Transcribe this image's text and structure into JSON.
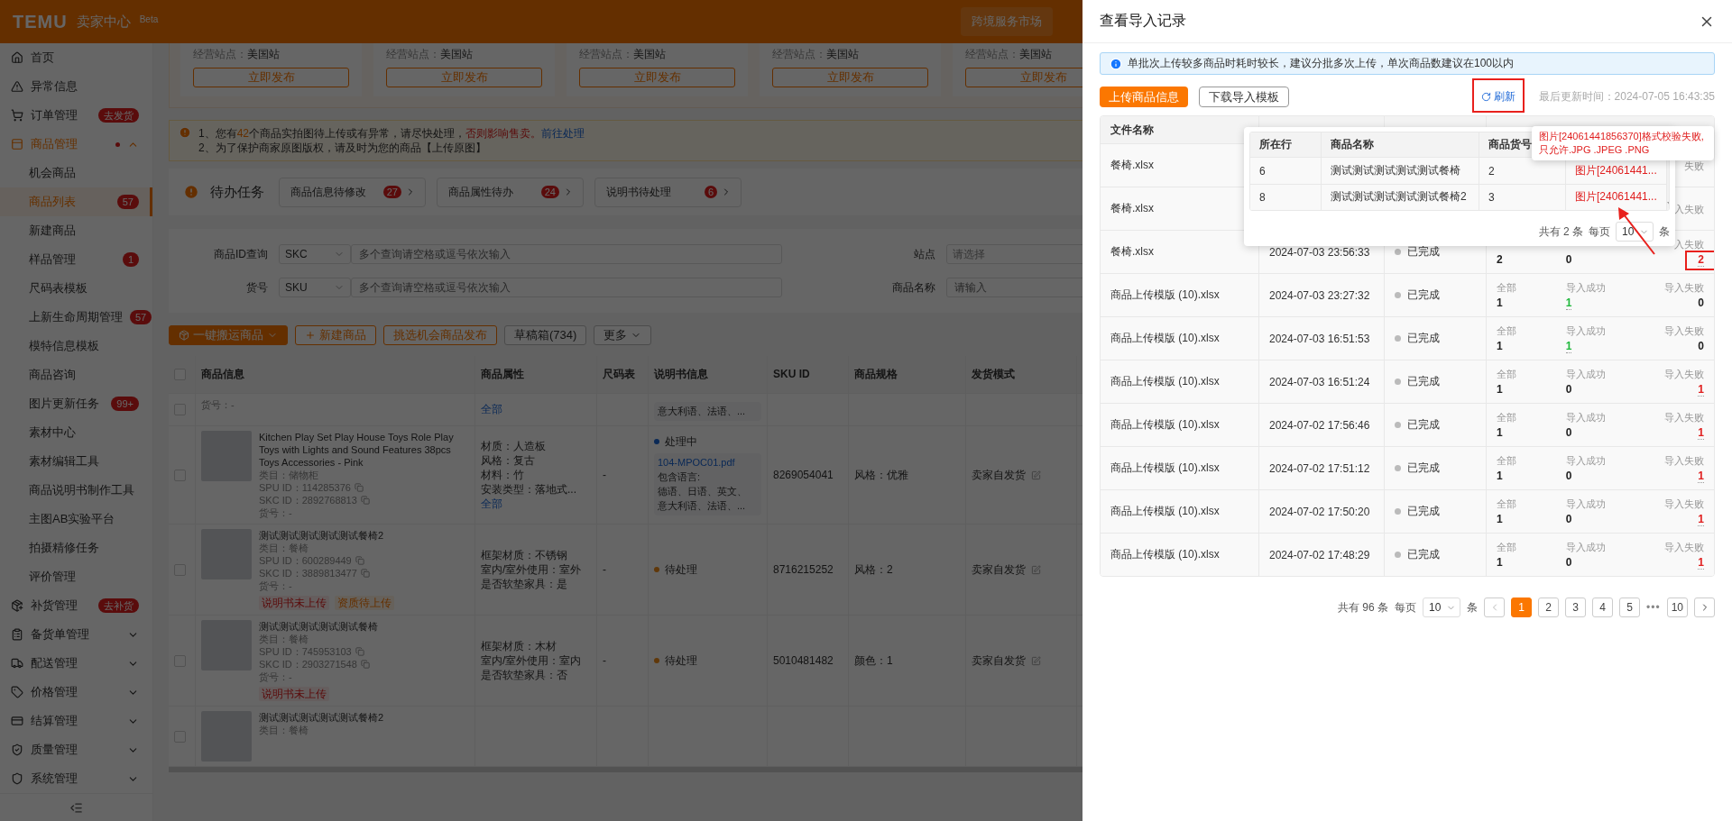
{
  "header": {
    "logo": "TEMU",
    "product": "卖家中心",
    "badge": "Beta",
    "market_button": "跨境服务市场"
  },
  "sidebar": {
    "items": [
      {
        "label": "首页",
        "selected": false
      },
      {
        "label": "异常信息",
        "selected": false
      },
      {
        "label": "订单管理",
        "selected": false,
        "tag": "去发货"
      },
      {
        "label": "商品管理",
        "selected": false,
        "expanded": true,
        "dot": true,
        "children": [
          {
            "label": "机会商品",
            "selected": false
          },
          {
            "label": "商品列表",
            "selected": true,
            "count": "57"
          },
          {
            "label": "新建商品",
            "selected": false
          },
          {
            "label": "样品管理",
            "selected": false,
            "count": "1"
          },
          {
            "label": "尺码表模板",
            "selected": false
          },
          {
            "label": "上新生命周期管理",
            "selected": false,
            "count": "57"
          },
          {
            "label": "模特信息模板",
            "selected": false
          },
          {
            "label": "商品咨询",
            "selected": false
          },
          {
            "label": "图片更新任务",
            "selected": false,
            "count": "99+"
          },
          {
            "label": "素材中心",
            "selected": false
          },
          {
            "label": "素材编辑工具",
            "selected": false
          },
          {
            "label": "商品说明书制作工具",
            "selected": false
          },
          {
            "label": "主图AB实验平台",
            "selected": false
          },
          {
            "label": "拍摄精修任务",
            "selected": false
          },
          {
            "label": "评价管理",
            "selected": false
          }
        ]
      },
      {
        "label": "补货管理",
        "selected": false,
        "tag": "去补货"
      },
      {
        "label": "备货单管理",
        "selected": false,
        "expanded": false
      },
      {
        "label": "配送管理",
        "selected": false,
        "expanded": false
      },
      {
        "label": "价格管理",
        "selected": false,
        "expanded": false
      },
      {
        "label": "结算管理",
        "selected": false,
        "expanded": false
      },
      {
        "label": "质量管理",
        "selected": false,
        "expanded": false
      },
      {
        "label": "系统管理",
        "selected": false,
        "expanded": false
      }
    ]
  },
  "publish_cards": [
    {
      "site_label": "经营站点：",
      "site": "美国站",
      "button": "立即发布"
    },
    {
      "site_label": "经营站点：",
      "site": "美国站",
      "button": "立即发布"
    },
    {
      "site_label": "经营站点：",
      "site": "美国站",
      "button": "立即发布"
    },
    {
      "site_label": "经营站点：",
      "site": "美国站",
      "button": "立即发布"
    },
    {
      "site_label": "经营站点：",
      "site": "美国站",
      "button": "立即发布"
    }
  ],
  "notice": {
    "lines": [
      [
        {
          "text": "1、您有",
          "kind": "plain"
        },
        {
          "text": "42",
          "kind": "count"
        },
        {
          "text": "个商品实拍图待上传或有异常，请尽快处理，",
          "kind": "plain"
        },
        {
          "text": "否则影响售卖。",
          "kind": "warning"
        },
        {
          "text": "前往处理",
          "kind": "link"
        }
      ],
      [
        {
          "text": "2、为了保护商家原图版权，请及时为您的商品【上传原图】",
          "kind": "plain"
        }
      ]
    ]
  },
  "todo": {
    "title": "待办任务",
    "items": [
      {
        "label": "商品信息待修改",
        "count": "27"
      },
      {
        "label": "商品属性待办",
        "count": "24"
      },
      {
        "label": "说明书待处理",
        "count": "6"
      }
    ]
  },
  "filters": [
    {
      "kind": "combo",
      "label": "商品ID查询",
      "select": "SKC",
      "placeholder": "多个查询请空格或逗号依次输入"
    },
    {
      "kind": "select",
      "label": "站点",
      "placeholder": "请选择"
    },
    {
      "kind": "combo",
      "label": "货号",
      "select": "SKU",
      "placeholder": "多个查询请空格或逗号依次输入"
    },
    {
      "kind": "input",
      "label": "商品名称",
      "placeholder": "请输入"
    }
  ],
  "actions": [
    {
      "label": "一键搬运商品",
      "kind": "primary"
    },
    {
      "label": "新建商品",
      "kind": "add"
    },
    {
      "label": "挑选机会商品发布",
      "kind": "outline"
    },
    {
      "label": "草稿箱(734)",
      "kind": "plain"
    },
    {
      "label": "更多",
      "kind": "menu"
    }
  ],
  "product_table": {
    "select_all_checked": false,
    "columns": [
      "商品信息",
      "商品属性",
      "尺码表",
      "说明书信息",
      "SKU ID",
      "商品规格",
      "发货模式"
    ],
    "rows": [
      {
        "checked": false,
        "info": [
          "货号：-"
        ],
        "attributes_more": "全部",
        "manual": {
          "languages": [
            "意大利语、法语、..."
          ]
        }
      },
      {
        "checked": false,
        "photo": true,
        "title": "Kitchen Play Set Play House Toys Role Play Toys with Lights and Sound Features 38pcs Toys Accessories - Pink",
        "category": "类目：储物柜",
        "spu": "SPU ID：114285376",
        "skc": "SKC ID：2892768813",
        "item_no": "货号：-",
        "attributes": [
          "材质：人造板",
          "风格：复古",
          "材料：竹",
          "安装类型：落地式..."
        ],
        "attributes_more": "全部",
        "size_chart": "-",
        "manual": {
          "status": "处理中",
          "kind": "processing",
          "file": "104-MPOC01.pdf",
          "languages_label": "包含语言:",
          "languages": [
            "德语、日语、英文、",
            "意大利语、法语、..."
          ]
        },
        "sku_id": "8269054041",
        "spec": "风格：优雅",
        "shipping": "卖家自发货"
      },
      {
        "checked": false,
        "photo": true,
        "title": "测试测试测试测试测试餐椅2",
        "category": "类目：餐椅",
        "spu": "SPU ID：600289449",
        "skc": "SKC ID：3889813477",
        "item_no": "货号：-",
        "tags": [
          {
            "label": "说明书未上传",
            "kind": "error"
          },
          {
            "label": "资质待上传",
            "kind": "warning"
          }
        ],
        "attributes": [
          "框架材质：不锈钢",
          "室内/室外使用：室外",
          "是否软垫家具：是"
        ],
        "size_chart": "-",
        "manual": {
          "status": "待处理",
          "kind": "pending"
        },
        "sku_id": "8716215252",
        "spec": "风格：2",
        "shipping": "卖家自发货"
      },
      {
        "checked": false,
        "photo": true,
        "title": "测试测试测试测试测试餐椅",
        "category": "类目：餐椅",
        "spu": "SPU ID：745953103",
        "skc": "SKC ID：2903271548",
        "item_no": "货号：-",
        "tags": [
          {
            "label": "说明书未上传",
            "kind": "error"
          }
        ],
        "attributes": [
          "框架材质：木材",
          "室内/室外使用：室内",
          "是否软垫家具：否"
        ],
        "size_chart": "-",
        "manual": {
          "status": "待处理",
          "kind": "pending"
        },
        "sku_id": "5010481482",
        "spec": "颜色：1",
        "shipping": "卖家自发货"
      },
      {
        "checked": false,
        "photo": true,
        "title": "测试测试测试测试测试餐椅2",
        "category": "类目：餐椅"
      }
    ]
  },
  "import_drawer": {
    "title": "查看导入记录",
    "alert": "单批次上传较多商品时耗时较长，建议分批多次上传，单次商品数建议在100以内",
    "upload_button": "上传商品信息",
    "download_button": "下载导入模板",
    "refresh": "刷新",
    "last_update": "最后更新时间：2024-07-05 16:43:35",
    "columns": [
      "文件名称"
    ],
    "rows": [
      {
        "file": "餐椅.xlsx",
        "failed_label": "失败"
      },
      {
        "file": "餐椅.xlsx",
        "failed_label": "入失败"
      },
      {
        "file": "餐椅.xlsx",
        "time": "2024-07-03 23:56:33",
        "status": "已完成",
        "total": "2",
        "success": "0",
        "failed_label": "入失败",
        "failed": "2"
      },
      {
        "file": "商品上传模版 (10).xlsx",
        "time": "2024-07-03 23:27:32",
        "status": "已完成",
        "total_label": "全部",
        "total": "1",
        "success_label": "导入成功",
        "success": "1",
        "failed_label": "导入失败",
        "failed": "0"
      },
      {
        "file": "商品上传模版 (10).xlsx",
        "time": "2024-07-03 16:51:53",
        "status": "已完成",
        "total_label": "全部",
        "total": "1",
        "success_label": "导入成功",
        "success": "1",
        "failed_label": "导入失败",
        "failed": "0"
      },
      {
        "file": "商品上传模版 (10).xlsx",
        "time": "2024-07-03 16:51:24",
        "status": "已完成",
        "total_label": "全部",
        "total": "1",
        "success_label": "导入成功",
        "success": "0",
        "failed_label": "导入失败",
        "failed": "1"
      },
      {
        "file": "商品上传模版 (10).xlsx",
        "time": "2024-07-02 17:56:46",
        "status": "已完成",
        "total_label": "全部",
        "total": "1",
        "success_label": "导入成功",
        "success": "0",
        "failed_label": "导入失败",
        "failed": "1"
      },
      {
        "file": "商品上传模版 (10).xlsx",
        "time": "2024-07-02 17:51:12",
        "status": "已完成",
        "total_label": "全部",
        "total": "1",
        "success_label": "导入成功",
        "success": "0",
        "failed_label": "导入失败",
        "failed": "1"
      },
      {
        "file": "商品上传模版 (10).xlsx",
        "time": "2024-07-02 17:50:20",
        "status": "已完成",
        "total_label": "全部",
        "total": "1",
        "success_label": "导入成功",
        "success": "0",
        "failed_label": "导入失败",
        "failed": "1"
      },
      {
        "file": "商品上传模版 (10).xlsx",
        "time": "2024-07-02 17:48:29",
        "status": "已完成",
        "total_label": "全部",
        "total": "1",
        "success_label": "导入成功",
        "success": "0",
        "failed_label": "导入失败",
        "failed": "1"
      }
    ],
    "pagination": {
      "total": "共有 96 条",
      "per_page_label": "每页",
      "page_size": "10",
      "unit": "条",
      "pages": [
        {
          "label": "1",
          "selected": true
        },
        {
          "label": "2",
          "selected": false
        },
        {
          "label": "3",
          "selected": false
        },
        {
          "label": "4",
          "selected": false
        },
        {
          "label": "5",
          "selected": false
        },
        {
          "label": "•••",
          "kind": "ellipsis"
        },
        {
          "label": "10",
          "selected": false
        }
      ]
    },
    "error_popover": {
      "columns": [
        "所在行",
        "商品名称",
        "商品货号"
      ],
      "rows": [
        {
          "cells": [
            "6",
            "测试测试测试测试测试餐椅",
            "2",
            "图片[24061441..."
          ]
        },
        {
          "cells": [
            "8",
            "测试测试测试测试测试餐椅2",
            "3",
            "图片[24061441..."
          ]
        }
      ],
      "footer": {
        "total": "共有 2 条",
        "per_page_label": "每页",
        "page_size": "10",
        "unit": "条"
      }
    },
    "tooltip": [
      "图片[24061441856370]格式校验失败,",
      "只允许.JPG .JPEG .PNG"
    ]
  }
}
